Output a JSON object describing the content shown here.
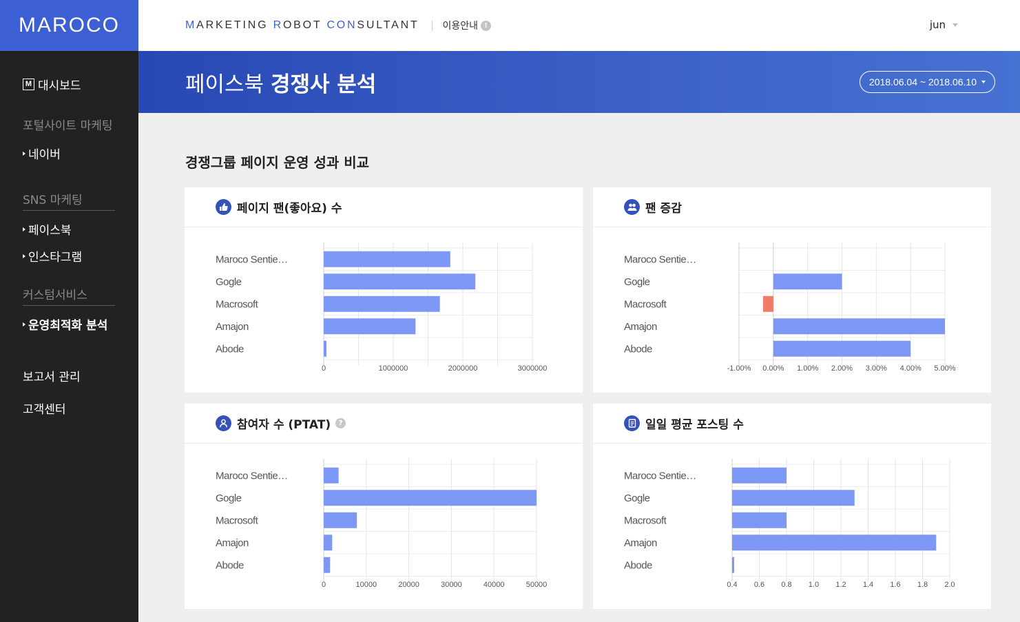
{
  "sidebar": {
    "logo": "MAROCO",
    "dashboard_icon": "M",
    "dashboard": "대시보드",
    "section_portal": "포털사이트 마케팅",
    "naver": "네이버",
    "section_sns": "SNS 마케팅",
    "facebook": "페이스북",
    "instagram": "인스타그램",
    "section_custom": "커스텀서비스",
    "optimization": "운영최적화 분석",
    "report": "보고서 관리",
    "support": "고객센터"
  },
  "header": {
    "brand": [
      "M",
      "ARKETING ",
      "R",
      "OBOT ",
      "CON",
      "SULTANT"
    ],
    "guide": "이용안내",
    "guide_icon": "!",
    "user": "jun"
  },
  "banner": {
    "title_light": "페이스북 ",
    "title_bold": "경쟁사 분석",
    "date_range": "2018.06.04 ~ 2018.06.10"
  },
  "section_title": "경쟁그룹 페이지 운영 성과 비교",
  "colors": {
    "bar": "#7d97f5",
    "negative": "#f07b6b",
    "accent": "#3d5fd4"
  },
  "cards": {
    "fans": {
      "title": "페이지 팬(좋아요) 수",
      "icon": "thumbs-up-icon"
    },
    "growth": {
      "title": "팬 증감",
      "icon": "people-icon"
    },
    "ptat": {
      "title": "참여자 수 (PTAT)",
      "icon": "person-icon",
      "help": "?"
    },
    "posting": {
      "title": "일일 평균 포스팅 수",
      "icon": "document-icon"
    }
  },
  "chart_data": [
    {
      "id": "fans",
      "type": "bar",
      "orientation": "horizontal",
      "categories": [
        "Maroco Sentie…",
        "Gogle",
        "Macrosoft",
        "Amajon",
        "Abode"
      ],
      "values": [
        1820000,
        2180000,
        1670000,
        1320000,
        40000
      ],
      "xlim": [
        0,
        3000000
      ],
      "ticks": [
        0,
        1000000,
        2000000,
        3000000
      ],
      "tick_labels": [
        "0",
        "1000000",
        "2000000",
        "3000000"
      ],
      "gridlines": [
        0,
        500000,
        1000000,
        1500000,
        2000000,
        2500000,
        3000000
      ]
    },
    {
      "id": "growth",
      "type": "bar",
      "orientation": "horizontal",
      "categories": [
        "Maroco Sentie…",
        "Gogle",
        "Macrosoft",
        "Amajon",
        "Abode"
      ],
      "values": [
        0,
        2.0,
        -0.3,
        5.0,
        4.0
      ],
      "xlim": [
        -1,
        5
      ],
      "ticks": [
        -1,
        0,
        1,
        2,
        3,
        4,
        5
      ],
      "tick_labels": [
        "-1.00%",
        "0.00%",
        "1.00%",
        "2.00%",
        "3.00%",
        "4.00%",
        "5.00%"
      ],
      "gridlines": [
        -1,
        0,
        1,
        2,
        3,
        4,
        5
      ]
    },
    {
      "id": "ptat",
      "type": "bar",
      "orientation": "horizontal",
      "categories": [
        "Maroco Sentie…",
        "Gogle",
        "Macrosoft",
        "Amajon",
        "Abode"
      ],
      "values": [
        3500,
        50000,
        7800,
        2000,
        1500
      ],
      "xlim": [
        0,
        50000
      ],
      "ticks": [
        0,
        10000,
        20000,
        30000,
        40000,
        50000
      ],
      "tick_labels": [
        "0",
        "10000",
        "20000",
        "30000",
        "40000",
        "50000"
      ],
      "gridlines": [
        0,
        10000,
        20000,
        30000,
        40000,
        50000
      ]
    },
    {
      "id": "posting",
      "type": "bar",
      "orientation": "horizontal",
      "categories": [
        "Maroco Sentie…",
        "Gogle",
        "Macrosoft",
        "Amajon",
        "Abode"
      ],
      "values": [
        0.8,
        1.3,
        0.8,
        1.9,
        0.4
      ],
      "xlim": [
        0.4,
        2.0
      ],
      "ticks": [
        0.4,
        0.6,
        0.8,
        1.0,
        1.2,
        1.4,
        1.6,
        1.8,
        2.0
      ],
      "tick_labels": [
        "0.4",
        "0.6",
        "0.8",
        "1.0",
        "1.2",
        "1.4",
        "1.6",
        "1.8",
        "2.0"
      ],
      "gridlines": [
        0.4,
        0.6,
        0.8,
        1.0,
        1.2,
        1.4,
        1.6,
        1.8,
        2.0
      ]
    }
  ]
}
